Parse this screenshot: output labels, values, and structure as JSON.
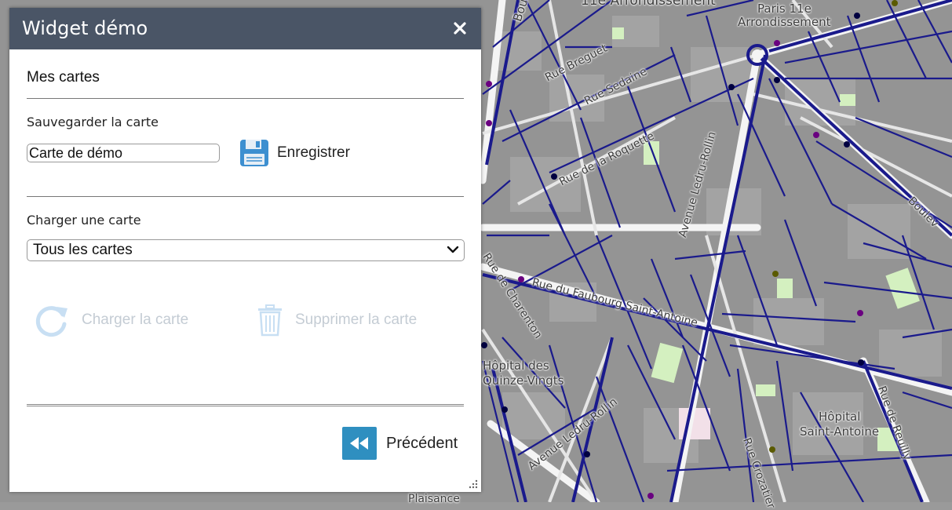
{
  "widget": {
    "title": "Widget démo",
    "section_title": "Mes cartes",
    "save_label": "Sauvegarder la carte",
    "name_input_value": "Carte de démo",
    "save_button": "Enregistrer",
    "load_label": "Charger une carte",
    "select_value": "Tous les cartes",
    "load_button": "Charger la carte",
    "delete_button": "Supprimer la carte",
    "prev_button": "Précédent"
  },
  "map": {
    "labels": {
      "arrondissement_top": "11e Arrondissement",
      "paris_11e_line1": "Paris 11e",
      "paris_11e_line2": "Arrondissement",
      "bd_voltaire": "Boulev",
      "rue_breguet": "Rue Breguet",
      "rue_sedaine": "Rue Sedaine",
      "rue_roquette": "Rue de la Roquette",
      "av_ledru_rollin_n": "Avenue Ledru-Rollin",
      "faubourg_st_antoine": "Rue du Faubourg Saint-Antoine",
      "rue_charenton": "Rue de Charenton",
      "hopital_qv_1": "Hôpital des",
      "hopital_qv_2": "Quinze-Vingts",
      "av_ledru_rollin_s": "Avenue Ledru-Rollin",
      "rue_crozatier": "Rue Crozatier",
      "hopital_sa_1": "Hôpital",
      "hopital_sa_2": "Saint-Antoine",
      "rue_reuilly": "Rue de Reuilly",
      "rue_charonne": "Rue de Charonne",
      "boulevard_right": "Boulev",
      "plaisance": "Plaisance",
      "rue_traversiere": "Rue de Cité"
    },
    "colors": {
      "street": "#1a1a8c",
      "block": "#8d8d8d",
      "road": "#f4f4f4",
      "park": "#d4f0c0"
    }
  }
}
